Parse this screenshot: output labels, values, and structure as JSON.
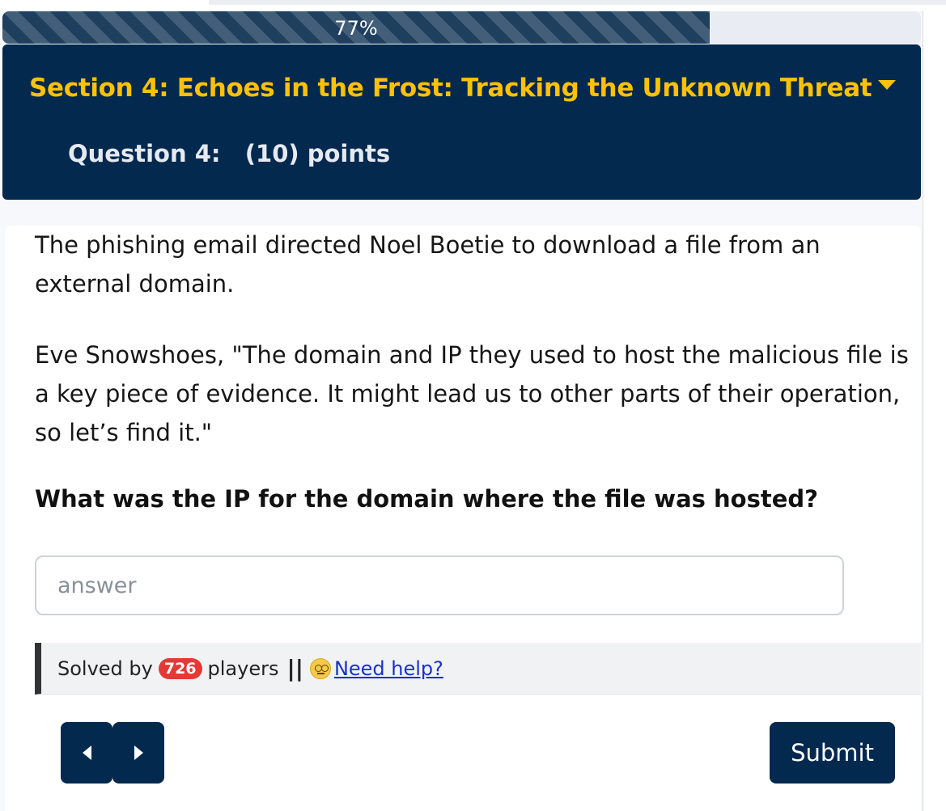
{
  "progress": {
    "label": "77%",
    "value": 0.77,
    "fill_color": "#1f3f5f"
  },
  "header": {
    "section_title": "Section 4: Echoes in the Frost: Tracking the Unknown Threat",
    "question_title": "Question 4:   (10) points",
    "background": "#03294f",
    "accent": "#ffc107"
  },
  "body": {
    "paragraph1": "The phishing email directed Noel Boetie to download a file from an external domain.",
    "paragraph2": "Eve Snowshoes, \"The domain and IP they used to host the malicious file is a key piece of evidence. It might lead us to other parts of their operation, so let’s find it.\"",
    "question": "What was the IP for the domain where the file was hosted?"
  },
  "answer": {
    "placeholder": "answer",
    "value": ""
  },
  "solved": {
    "prefix": "Solved by",
    "count": "726",
    "suffix": "players",
    "separator": "||",
    "help_label": "Need help?",
    "icon": "dizzy-face-icon",
    "badge_color": "#e53935"
  },
  "nav": {
    "prev_icon": "caret-left-icon",
    "next_icon": "caret-right-icon"
  },
  "submit_label": "Submit"
}
